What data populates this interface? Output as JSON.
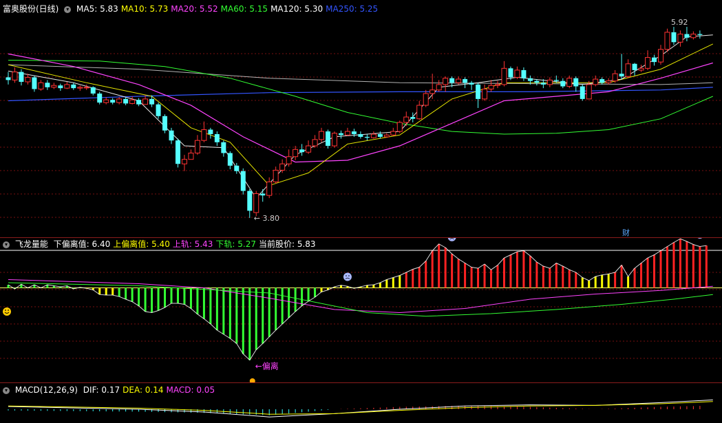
{
  "main": {
    "title": "富奥股份(日线)",
    "indicators": [
      {
        "label": "MA5: 5.83",
        "color": "#ffffff"
      },
      {
        "label": "MA10: 5.73",
        "color": "#ffff00"
      },
      {
        "label": "MA20: 5.52",
        "color": "#ff44ff"
      },
      {
        "label": "MA60: 5.15",
        "color": "#33ff33"
      },
      {
        "label": "MA120: 5.30",
        "color": "#ffffff"
      },
      {
        "label": "MA250: 5.25",
        "color": "#3355ff"
      }
    ],
    "high_label": "5.92",
    "low_label": "3.80",
    "fin_label": "财"
  },
  "sub1": {
    "title": "飞龙量能",
    "indicators": [
      {
        "label": "下偏离值: 6.40",
        "color": "#ffffff"
      },
      {
        "label": "上偏离值: 5.40",
        "color": "#ffff00"
      },
      {
        "label": "上轨: 5.43",
        "color": "#ff44ff"
      },
      {
        "label": "下轨: 5.27",
        "color": "#33ff33"
      },
      {
        "label": "当前股价: 5.83",
        "color": "#ffffff"
      }
    ],
    "annotation": "偏离"
  },
  "sub2": {
    "title": "MACD(12,26,9)",
    "indicators": [
      {
        "label": "DIF: 0.17",
        "color": "#ffffff"
      },
      {
        "label": "DEA: 0.14",
        "color": "#ffff00"
      },
      {
        "label": "MACD: 0.05",
        "color": "#ff44ff"
      }
    ]
  },
  "colors": {
    "up": "#ff3333",
    "down": "#55ffff",
    "ma5": "#ffffff",
    "ma10": "#ffff00",
    "ma20": "#ff44ff",
    "ma60": "#33ff33",
    "ma120": "#ffffff",
    "ma250": "#3355ff",
    "grid": "#7a1010"
  },
  "chart_data": [
    {
      "type": "candlestick",
      "title": "富奥股份(日线)",
      "ylim": [
        3.7,
        6.05
      ],
      "candles": [
        [
          5.36,
          5.33,
          5.42,
          5.28
        ],
        [
          5.33,
          5.42,
          5.47,
          5.3
        ],
        [
          5.42,
          5.31,
          5.45,
          5.27
        ],
        [
          5.31,
          5.36,
          5.4,
          5.28
        ],
        [
          5.36,
          5.23,
          5.38,
          5.2
        ],
        [
          5.23,
          5.3,
          5.33,
          5.21
        ],
        [
          5.3,
          5.25,
          5.33,
          5.22
        ],
        [
          5.25,
          5.27,
          5.3,
          5.23
        ],
        [
          5.27,
          5.24,
          5.29,
          5.21
        ],
        [
          5.24,
          5.28,
          5.31,
          5.23
        ],
        [
          5.28,
          5.24,
          5.3,
          5.22
        ],
        [
          5.24,
          5.25,
          5.27,
          5.21
        ],
        [
          5.25,
          5.25,
          5.28,
          5.22
        ],
        [
          5.25,
          5.18,
          5.26,
          5.16
        ],
        [
          5.18,
          5.08,
          5.2,
          5.06
        ],
        [
          5.08,
          5.11,
          5.14,
          5.06
        ],
        [
          5.11,
          5.08,
          5.13,
          5.06
        ],
        [
          5.08,
          5.12,
          5.14,
          5.06
        ],
        [
          5.12,
          5.07,
          5.14,
          5.05
        ],
        [
          5.07,
          5.11,
          5.15,
          5.06
        ],
        [
          5.11,
          5.06,
          5.13,
          5.04
        ],
        [
          5.06,
          5.12,
          5.16,
          5.06
        ],
        [
          5.12,
          5.06,
          5.16,
          5.03
        ],
        [
          5.06,
          4.93,
          5.08,
          4.9
        ],
        [
          4.93,
          4.77,
          4.95,
          4.74
        ],
        [
          4.77,
          4.66,
          4.8,
          4.62
        ],
        [
          4.66,
          4.4,
          4.68,
          4.36
        ],
        [
          4.4,
          4.45,
          4.5,
          4.32
        ],
        [
          4.45,
          4.52,
          4.56,
          4.45
        ],
        [
          4.52,
          4.66,
          4.72,
          4.5
        ],
        [
          4.66,
          4.78,
          4.87,
          4.64
        ],
        [
          4.78,
          4.73,
          4.8,
          4.68
        ],
        [
          4.73,
          4.64,
          4.76,
          4.6
        ],
        [
          4.64,
          4.52,
          4.66,
          4.48
        ],
        [
          4.52,
          4.38,
          4.54,
          4.34
        ],
        [
          4.38,
          4.32,
          4.41,
          4.29
        ],
        [
          4.32,
          4.1,
          4.35,
          4.06
        ],
        [
          4.1,
          3.88,
          4.12,
          3.8
        ],
        [
          3.86,
          4.07,
          4.1,
          3.82
        ],
        [
          4.07,
          4.05,
          4.12,
          3.98
        ],
        [
          4.05,
          4.2,
          4.25,
          4.02
        ],
        [
          4.2,
          4.33,
          4.37,
          4.18
        ],
        [
          4.33,
          4.4,
          4.45,
          4.3
        ],
        [
          4.4,
          4.48,
          4.56,
          4.37
        ],
        [
          4.48,
          4.56,
          4.6,
          4.44
        ],
        [
          4.56,
          4.53,
          4.62,
          4.49
        ],
        [
          4.53,
          4.6,
          4.66,
          4.51
        ],
        [
          4.6,
          4.67,
          4.72,
          4.58
        ],
        [
          4.67,
          4.76,
          4.8,
          4.64
        ],
        [
          4.76,
          4.6,
          4.78,
          4.57
        ],
        [
          4.6,
          4.74,
          4.76,
          4.58
        ],
        [
          4.74,
          4.72,
          4.77,
          4.68
        ],
        [
          4.72,
          4.76,
          4.8,
          4.71
        ],
        [
          4.76,
          4.73,
          4.79,
          4.7
        ],
        [
          4.73,
          4.7,
          4.76,
          4.68
        ],
        [
          4.7,
          4.69,
          4.73,
          4.66
        ],
        [
          4.69,
          4.73,
          4.76,
          4.68
        ],
        [
          4.73,
          4.7,
          4.76,
          4.68
        ],
        [
          4.7,
          4.72,
          4.74,
          4.69
        ],
        [
          4.72,
          4.76,
          4.8,
          4.71
        ],
        [
          4.76,
          4.86,
          4.88,
          4.74
        ],
        [
          4.86,
          4.92,
          4.98,
          4.82
        ],
        [
          4.92,
          4.9,
          4.97,
          4.86
        ],
        [
          4.9,
          5.05,
          5.1,
          4.89
        ],
        [
          5.05,
          5.18,
          5.22,
          5.03
        ],
        [
          5.18,
          5.22,
          5.4,
          5.12
        ],
        [
          5.22,
          5.28,
          5.33,
          5.2
        ],
        [
          5.28,
          5.35,
          5.37,
          5.2
        ],
        [
          5.35,
          5.3,
          5.37,
          5.25
        ],
        [
          5.3,
          5.34,
          5.37,
          5.28
        ],
        [
          5.34,
          5.3,
          5.36,
          5.24
        ],
        [
          5.3,
          5.28,
          5.32,
          5.22
        ],
        [
          5.28,
          5.12,
          5.3,
          5.02
        ],
        [
          5.12,
          5.23,
          5.28,
          5.1
        ],
        [
          5.23,
          5.27,
          5.33,
          5.2
        ],
        [
          5.27,
          5.28,
          5.32,
          5.24
        ],
        [
          5.28,
          5.46,
          5.54,
          5.26
        ],
        [
          5.46,
          5.36,
          5.48,
          5.33
        ],
        [
          5.36,
          5.44,
          5.48,
          5.34
        ],
        [
          5.44,
          5.35,
          5.47,
          5.32
        ],
        [
          5.35,
          5.32,
          5.38,
          5.28
        ],
        [
          5.32,
          5.3,
          5.34,
          5.27
        ],
        [
          5.3,
          5.28,
          5.34,
          5.24
        ],
        [
          5.28,
          5.33,
          5.36,
          5.25
        ],
        [
          5.33,
          5.32,
          5.38,
          5.3
        ],
        [
          5.32,
          5.26,
          5.35,
          5.24
        ],
        [
          5.26,
          5.35,
          5.38,
          5.24
        ],
        [
          5.35,
          5.26,
          5.37,
          5.2
        ],
        [
          5.26,
          5.12,
          5.28,
          5.1
        ],
        [
          5.12,
          5.28,
          5.32,
          5.12
        ],
        [
          5.28,
          5.34,
          5.38,
          5.26
        ],
        [
          5.34,
          5.3,
          5.36,
          5.28
        ],
        [
          5.3,
          5.32,
          5.35,
          5.28
        ],
        [
          5.32,
          5.4,
          5.44,
          5.3
        ],
        [
          5.4,
          5.37,
          5.62,
          5.34
        ],
        [
          5.37,
          5.51,
          5.56,
          5.35
        ],
        [
          5.51,
          5.44,
          5.52,
          5.38
        ],
        [
          5.44,
          5.46,
          5.5,
          5.42
        ],
        [
          5.46,
          5.58,
          5.66,
          5.44
        ],
        [
          5.58,
          5.53,
          5.61,
          5.49
        ],
        [
          5.53,
          5.67,
          5.72,
          5.5
        ],
        [
          5.67,
          5.86,
          5.9,
          5.64
        ],
        [
          5.86,
          5.75,
          5.92,
          5.72
        ],
        [
          5.75,
          5.84,
          5.88,
          5.7
        ],
        [
          5.84,
          5.8,
          5.92,
          5.76
        ],
        [
          5.8,
          5.84,
          5.87,
          5.78
        ],
        [
          5.84,
          5.83,
          5.88,
          5.79
        ]
      ],
      "ma": {
        "MA5": [
          [
            0,
            5.43
          ],
          [
            10,
            5.3
          ],
          [
            20,
            5.1
          ],
          [
            27,
            4.6
          ],
          [
            33,
            4.58
          ],
          [
            38,
            4.02
          ],
          [
            44,
            4.5
          ],
          [
            50,
            4.7
          ],
          [
            60,
            4.76
          ],
          [
            66,
            5.25
          ],
          [
            72,
            5.3
          ],
          [
            78,
            5.36
          ],
          [
            88,
            5.28
          ],
          [
            94,
            5.34
          ],
          [
            100,
            5.6
          ],
          [
            104,
            5.81
          ],
          [
            108,
            5.83
          ]
        ],
        "MA10": [
          [
            0,
            5.5
          ],
          [
            12,
            5.3
          ],
          [
            22,
            5.15
          ],
          [
            28,
            4.8
          ],
          [
            34,
            4.64
          ],
          [
            40,
            4.16
          ],
          [
            46,
            4.3
          ],
          [
            52,
            4.62
          ],
          [
            60,
            4.72
          ],
          [
            68,
            5.12
          ],
          [
            76,
            5.3
          ],
          [
            84,
            5.3
          ],
          [
            92,
            5.3
          ],
          [
            100,
            5.45
          ],
          [
            108,
            5.73
          ]
        ],
        "MA20": [
          [
            0,
            5.62
          ],
          [
            10,
            5.48
          ],
          [
            20,
            5.28
          ],
          [
            28,
            5.05
          ],
          [
            36,
            4.7
          ],
          [
            44,
            4.42
          ],
          [
            52,
            4.44
          ],
          [
            60,
            4.6
          ],
          [
            68,
            4.85
          ],
          [
            76,
            5.1
          ],
          [
            84,
            5.15
          ],
          [
            92,
            5.2
          ],
          [
            100,
            5.35
          ],
          [
            108,
            5.52
          ]
        ],
        "MA60": [
          [
            0,
            5.55
          ],
          [
            14,
            5.54
          ],
          [
            24,
            5.48
          ],
          [
            34,
            5.35
          ],
          [
            44,
            5.15
          ],
          [
            52,
            4.97
          ],
          [
            60,
            4.85
          ],
          [
            68,
            4.76
          ],
          [
            76,
            4.73
          ],
          [
            84,
            4.74
          ],
          [
            92,
            4.78
          ],
          [
            100,
            4.9
          ],
          [
            108,
            5.15
          ]
        ],
        "MA120": [
          [
            0,
            5.5
          ],
          [
            20,
            5.45
          ],
          [
            40,
            5.35
          ],
          [
            60,
            5.3
          ],
          [
            80,
            5.29
          ],
          [
            100,
            5.28
          ],
          [
            108,
            5.3
          ]
        ],
        "MA250": [
          [
            0,
            5.1
          ],
          [
            20,
            5.15
          ],
          [
            40,
            5.19
          ],
          [
            60,
            5.2
          ],
          [
            80,
            5.2
          ],
          [
            100,
            5.22
          ],
          [
            108,
            5.25
          ]
        ]
      }
    },
    {
      "type": "bar",
      "title": "飞龙量能",
      "ylim": [
        3.7,
        6.1
      ],
      "upper_band": [
        [
          0,
          5.56
        ],
        [
          20,
          5.48
        ],
        [
          30,
          5.4
        ],
        [
          40,
          5.2
        ],
        [
          50,
          4.98
        ],
        [
          60,
          4.92
        ],
        [
          70,
          5.0
        ],
        [
          80,
          5.18
        ],
        [
          90,
          5.28
        ],
        [
          100,
          5.35
        ],
        [
          108,
          5.43
        ]
      ],
      "lower_band": [
        [
          0,
          5.5
        ],
        [
          20,
          5.44
        ],
        [
          40,
          5.3
        ],
        [
          55,
          4.92
        ],
        [
          64,
          4.85
        ],
        [
          74,
          4.9
        ],
        [
          84,
          4.98
        ],
        [
          94,
          5.08
        ],
        [
          102,
          5.18
        ],
        [
          108,
          5.27
        ]
      ],
      "yellow_line": 5.4,
      "bar_values": [
        0.06,
        -0.02,
        0.07,
        0.0,
        0.06,
        0.0,
        0.06,
        0.04,
        0.02,
        0.04,
        -0.02,
        0.01,
        -0.01,
        -0.04,
        -0.13,
        -0.14,
        -0.14,
        -0.17,
        -0.22,
        -0.27,
        -0.35,
        -0.46,
        -0.48,
        -0.44,
        -0.38,
        -0.3,
        -0.3,
        -0.32,
        -0.4,
        -0.51,
        -0.6,
        -0.7,
        -0.82,
        -0.9,
        -0.98,
        -1.08,
        -1.28,
        -1.4,
        -1.2,
        -1.08,
        -0.95,
        -0.82,
        -0.7,
        -0.58,
        -0.46,
        -0.35,
        -0.26,
        -0.18,
        -0.08,
        -0.04,
        0.02,
        0.05,
        0.03,
        -0.01,
        0.02,
        0.05,
        0.06,
        0.1,
        0.16,
        0.2,
        0.24,
        0.3,
        0.36,
        0.4,
        0.52,
        0.72,
        0.85,
        0.78,
        0.66,
        0.56,
        0.48,
        0.4,
        0.38,
        0.46,
        0.35,
        0.44,
        0.58,
        0.64,
        0.7,
        0.72,
        0.62,
        0.5,
        0.42,
        0.38,
        0.48,
        0.42,
        0.35,
        0.3,
        0.2,
        0.14,
        0.22,
        0.25,
        0.27,
        0.3,
        0.44,
        0.22,
        0.38,
        0.48,
        0.58,
        0.64,
        0.72,
        0.8,
        0.88,
        0.95,
        0.9,
        0.84,
        0.8,
        0.82
      ]
    },
    {
      "type": "bar",
      "title": "MACD(12,26,9)",
      "ylim": [
        -0.25,
        0.25
      ],
      "dif": [
        [
          0,
          0.05
        ],
        [
          20,
          0.0
        ],
        [
          30,
          -0.05
        ],
        [
          40,
          -0.14
        ],
        [
          50,
          -0.08
        ],
        [
          60,
          0.0
        ],
        [
          70,
          0.06
        ],
        [
          80,
          0.08
        ],
        [
          90,
          0.07
        ],
        [
          100,
          0.12
        ],
        [
          108,
          0.17
        ]
      ],
      "dea": [
        [
          0,
          0.06
        ],
        [
          20,
          0.02
        ],
        [
          30,
          -0.02
        ],
        [
          40,
          -0.09
        ],
        [
          50,
          -0.08
        ],
        [
          60,
          -0.02
        ],
        [
          70,
          0.03
        ],
        [
          80,
          0.06
        ],
        [
          90,
          0.07
        ],
        [
          100,
          0.1
        ],
        [
          108,
          0.14
        ]
      ]
    }
  ]
}
